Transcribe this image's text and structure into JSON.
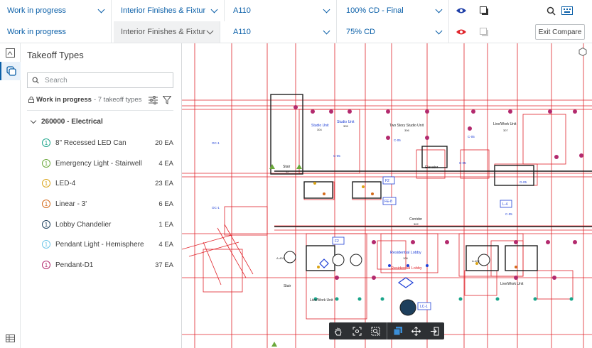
{
  "compare_row_1": {
    "status": "Work in progress",
    "discipline": "Interior Finishes & Fixtur",
    "sheet": "A110",
    "version": "100% CD - Final"
  },
  "compare_row_2": {
    "status": "Work in progress",
    "discipline": "Interior Finishes & Fixtur",
    "sheet": "A110",
    "version": "75% CD",
    "exit_label": "Exit Compare"
  },
  "colors": {
    "accent": "#0a5fa8",
    "row1_eye": "#1f3fa8",
    "row2_eye": "#e0242b",
    "drawing_red": "#e0242b",
    "drawing_blue": "#1e3fd6"
  },
  "takeoff": {
    "title": "Takeoff Types",
    "search_placeholder": "Search",
    "status_label": "Work in progress",
    "status_sub": "- 7 takeoff types",
    "group_label": "260000 - Electrical",
    "items": [
      {
        "num": "1",
        "label": "8\" Recessed LED Can",
        "qty": "20 EA",
        "color": "#1aa58a"
      },
      {
        "num": "1",
        "label": "Emergency Light - Stairwell",
        "qty": "4 EA",
        "color": "#6aa83a"
      },
      {
        "num": "1",
        "label": "LED-4",
        "qty": "23 EA",
        "color": "#d9a316"
      },
      {
        "num": "1",
        "label": "Linear - 3'",
        "qty": "6 EA",
        "color": "#d46a1a"
      },
      {
        "num": "1",
        "label": "Lobby Chandelier",
        "qty": "1 EA",
        "color": "#1d3f5c"
      },
      {
        "num": "1",
        "label": "Pendant Light - Hemisphere",
        "qty": "4 EA",
        "color": "#6ec6e8"
      },
      {
        "num": "1",
        "label": "Pendant-D1",
        "qty": "37 EA",
        "color": "#b32a6e"
      }
    ]
  },
  "drawing_labels": {
    "studio1": "Studio Unit",
    "studio2": "Studio Unit",
    "twostory": "Two Story Studio Unit",
    "livework1": "Live/Work Unit",
    "stair1": "Stair",
    "elevator": "Elevator",
    "corridor": "Corridor",
    "reslobby1": "Residential Lobby",
    "reslobby2": "Residential Lobby",
    "stair2": "Stair",
    "livework2": "Live/Work Unit",
    "livework3": "Live/Work Unit",
    "room304": "304",
    "room305": "305",
    "room306": "306",
    "room307": "307",
    "room302": "302",
    "room52": "52",
    "f2a": "F2",
    "f2b": "F2",
    "fe8": "FE-8",
    "l4": "L-4",
    "lc1": "LC-1",
    "c05a": "C-05",
    "c05b": "C-05",
    "c05c": "C-05",
    "c05d": "C-05",
    "c05e": "C-05",
    "g05": "G-05",
    "oc1a": "OC-1",
    "oc1b": "OC-1",
    "a402a": "A-402",
    "a402b": "A-402",
    "lobby106": "106"
  }
}
